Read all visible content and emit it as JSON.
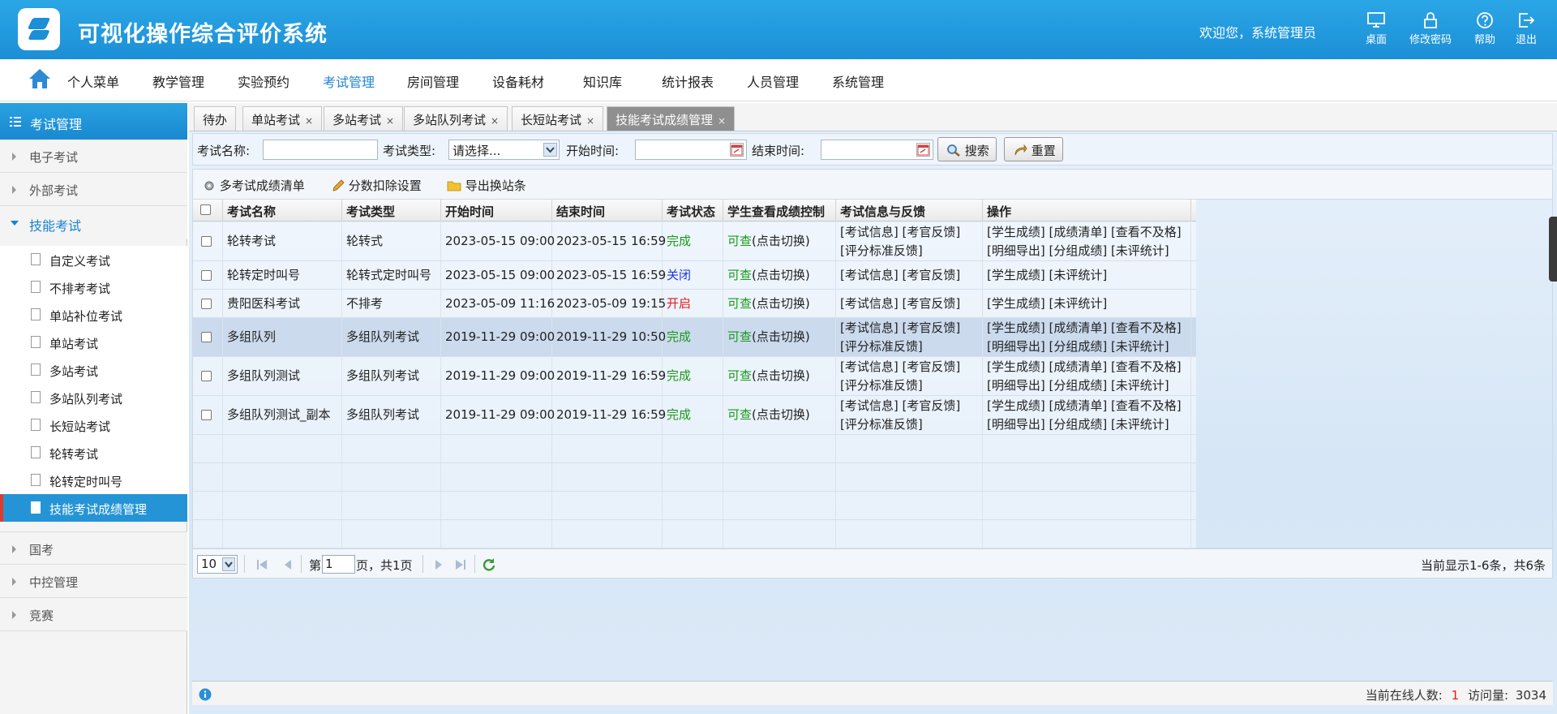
{
  "header": {
    "app_title": "可视化操作综合评价系统",
    "welcome": "欢迎您，系统管理员",
    "buttons": [
      {
        "label": "桌面",
        "icon": "desktop-icon"
      },
      {
        "label": "修改密码",
        "icon": "lock-icon"
      },
      {
        "label": "帮助",
        "icon": "help-icon"
      },
      {
        "label": "退出",
        "icon": "logout-icon"
      }
    ]
  },
  "nav": {
    "items": [
      "个人菜单",
      "教学管理",
      "实验预约",
      "考试管理",
      "房间管理",
      "设备耗材",
      "知识库",
      "统计报表",
      "人员管理",
      "系统管理"
    ],
    "active": "考试管理"
  },
  "sidebar": {
    "title": "考试管理",
    "groups": [
      "电子考试",
      "外部考试",
      "技能考试",
      "国考",
      "中控管理",
      "竞赛"
    ],
    "open_group": "技能考试",
    "sub_items": [
      "自定义考试",
      "不排考考试",
      "单站补位考试",
      "单站考试",
      "多站考试",
      "多站队列考试",
      "长短站考试",
      "轮转考试",
      "轮转定时叫号",
      "技能考试成绩管理"
    ],
    "active_sub": "技能考试成绩管理"
  },
  "tabs": [
    "待办",
    "单站考试",
    "多站考试",
    "多站队列考试",
    "长短站考试",
    "技能考试成绩管理"
  ],
  "tab_close": "×",
  "filter": {
    "name_label": "考试名称:",
    "type_label": "考试类型:",
    "type_value": "请选择...",
    "start_label": "开始时间:",
    "end_label": "结束时间:",
    "search_btn": "搜索",
    "reset_btn": "重置"
  },
  "toolbar": {
    "multi_list": "多考试成绩清单",
    "deduct": "分数扣除设置",
    "export": "导出换站条"
  },
  "table": {
    "columns": [
      "考试名称",
      "考试类型",
      "开始时间",
      "结束时间",
      "考试状态",
      "学生查看成绩控制",
      "考试信息与反馈",
      "操作"
    ],
    "rows": [
      {
        "name": "轮转考试",
        "type": "轮转式",
        "start": "2023-05-15 09:00",
        "end": "2023-05-15 16:59",
        "status": "完成",
        "status_color": "#1a9a1a",
        "view_a": "可查",
        "view_b": "(点击切换)",
        "info1": "[考试信息] [考官反馈]",
        "info2": "[评分标准反馈]",
        "ops1": "[学生成绩] [成绩清单] [查看不及格]",
        "ops2": "[明细导出] [分组成绩] [未评统计]"
      },
      {
        "name": "轮转定时叫号",
        "type": "轮转式定时叫号",
        "start": "2023-05-15 09:00",
        "end": "2023-05-15 16:59",
        "status": "关闭",
        "status_color": "#1d38d8",
        "view_a": "可查",
        "view_b": "(点击切换)",
        "info1": "[考试信息] [考官反馈]",
        "info2": "",
        "ops1": "[学生成绩] [未评统计]",
        "ops2": ""
      },
      {
        "name": "贵阳医科考试",
        "type": "不排考",
        "start": "2023-05-09 11:16",
        "end": "2023-05-09 19:15",
        "status": "开启",
        "status_color": "#e02020",
        "view_a": "可查",
        "view_b": "(点击切换)",
        "info1": "[考试信息] [考官反馈]",
        "info2": "",
        "ops1": "[学生成绩] [未评统计]",
        "ops2": ""
      },
      {
        "name": "多组队列",
        "type": "多组队列考试",
        "start": "2019-11-29 09:00",
        "end": "2019-11-29 10:50",
        "status": "完成",
        "status_color": "#1a9a1a",
        "view_a": "可查",
        "view_b": "(点击切换)",
        "info1": "[考试信息] [考官反馈]",
        "info2": "[评分标准反馈]",
        "ops1": "[学生成绩] [成绩清单] [查看不及格]",
        "ops2": "[明细导出] [分组成绩] [未评统计]"
      },
      {
        "name": "多组队列测试",
        "type": "多组队列考试",
        "start": "2019-11-29 09:00",
        "end": "2019-11-29 16:59",
        "status": "完成",
        "status_color": "#1a9a1a",
        "view_a": "可查",
        "view_b": "(点击切换)",
        "info1": "[考试信息] [考官反馈]",
        "info2": "[评分标准反馈]",
        "ops1": "[学生成绩] [成绩清单] [查看不及格]",
        "ops2": "[明细导出] [分组成绩] [未评统计]"
      },
      {
        "name": "多组队列测试_副本",
        "type": "多组队列考试",
        "start": "2019-11-29 09:00",
        "end": "2019-11-29 16:59",
        "status": "完成",
        "status_color": "#1a9a1a",
        "view_a": "可查",
        "view_b": "(点击切换)",
        "info1": "[考试信息] [考官反馈]",
        "info2": "[评分标准反馈]",
        "ops1": "[学生成绩] [成绩清单] [查看不及格]",
        "ops2": "[明细导出] [分组成绩] [未评统计]"
      }
    ]
  },
  "pager": {
    "page_size": "10",
    "page_prefix": "第",
    "page_value": "1",
    "page_suffix": "页，共1页",
    "summary": "当前显示1-6条，共6条"
  },
  "footer": {
    "online_label": "当前在线人数:",
    "online_count": "1",
    "visits_label": "访问量:",
    "visits_count": "3034"
  }
}
